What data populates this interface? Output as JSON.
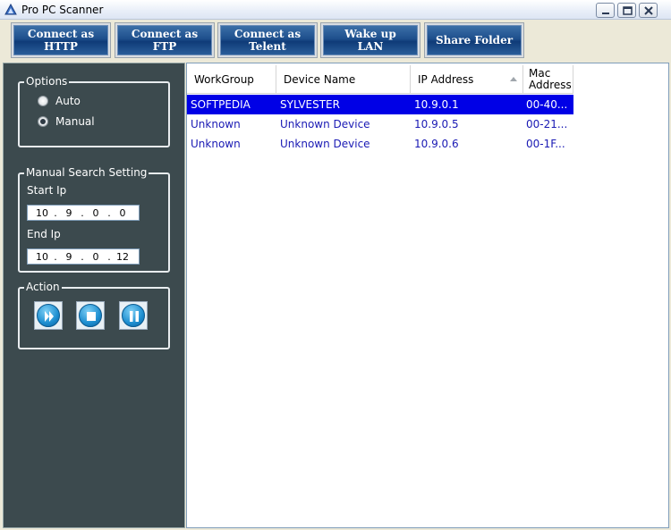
{
  "window": {
    "title": "Pro PC Scanner"
  },
  "toolbar": {
    "buttons": [
      {
        "line1": "Connect as",
        "line2": "HTTP"
      },
      {
        "line1": "Connect as",
        "line2": "FTP"
      },
      {
        "line1": "Connect as",
        "line2": "Telent"
      },
      {
        "line1": "Wake up",
        "line2": "LAN"
      },
      {
        "line1": "Share Folder",
        "line2": ""
      }
    ]
  },
  "options": {
    "label": "Options",
    "auto_label": "Auto",
    "manual_label": "Manual",
    "selected": "Manual"
  },
  "manual_search": {
    "label": "Manual Search Setting",
    "start_label": "Start Ip",
    "start_ip": [
      "10",
      "9",
      "0",
      "0"
    ],
    "end_label": "End Ip",
    "end_ip": [
      "10",
      "9",
      "0",
      "12"
    ]
  },
  "action": {
    "label": "Action",
    "buttons": [
      "play-icon",
      "stop-icon",
      "pause-icon"
    ]
  },
  "list": {
    "columns": [
      "WorkGroup",
      "Device Name",
      "IP Address",
      "Mac Address"
    ],
    "mac_header_line1": "Mac",
    "mac_header_line2": "Address",
    "sorted_column": "IP Address",
    "rows": [
      {
        "workgroup": "SOFTPEDIA",
        "device": "SYLVESTER",
        "ip": "10.9.0.1",
        "mac": "00-40..."
      },
      {
        "workgroup": "Unknown",
        "device": "Unknown Device",
        "ip": "10.9.0.5",
        "mac": "00-21..."
      },
      {
        "workgroup": "Unknown",
        "device": "Unknown Device",
        "ip": "10.9.0.6",
        "mac": "00-1F..."
      }
    ],
    "selected_row": 0
  },
  "colors": {
    "panel_bg": "#3c4a4e",
    "selection": "#0000e6",
    "row_text": "#1a1ab4",
    "button_blue": "#1e4f8c"
  }
}
